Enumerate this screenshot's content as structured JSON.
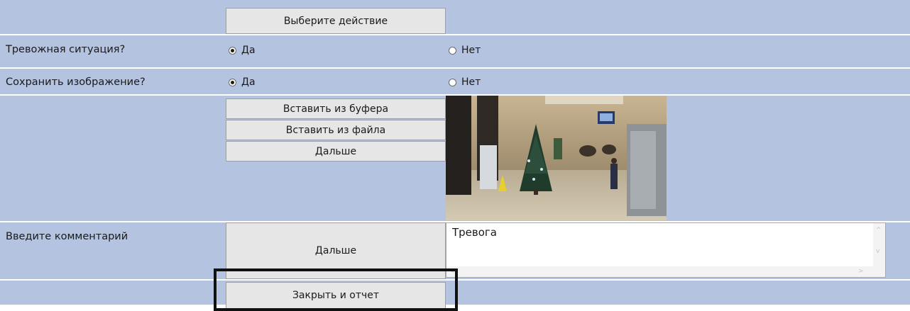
{
  "header": {
    "action_button_label": "Выберите действие"
  },
  "alarm_question": {
    "label": "Тревожная ситуация?",
    "options": [
      {
        "label": "Да",
        "checked": true
      },
      {
        "label": "Нет",
        "checked": false
      }
    ]
  },
  "save_image_question": {
    "label": "Сохранить изображение?",
    "options": [
      {
        "label": "Да",
        "checked": true
      },
      {
        "label": "Нет",
        "checked": false
      }
    ]
  },
  "image_section": {
    "paste_from_buffer_label": "Вставить из буфера",
    "paste_from_file_label": "Вставить из файла",
    "next_label": "Дальше",
    "photo_icon": "lobby-camera-snapshot"
  },
  "comment_section": {
    "label": "Введите комментарий",
    "next_label": "Дальше",
    "comment_value": "Тревога"
  },
  "footer": {
    "close_report_label": "Закрыть и отчет"
  },
  "colors": {
    "row_background": "#b3c3e0",
    "button_background": "#e6e6e6",
    "highlight_border": "#111111"
  }
}
